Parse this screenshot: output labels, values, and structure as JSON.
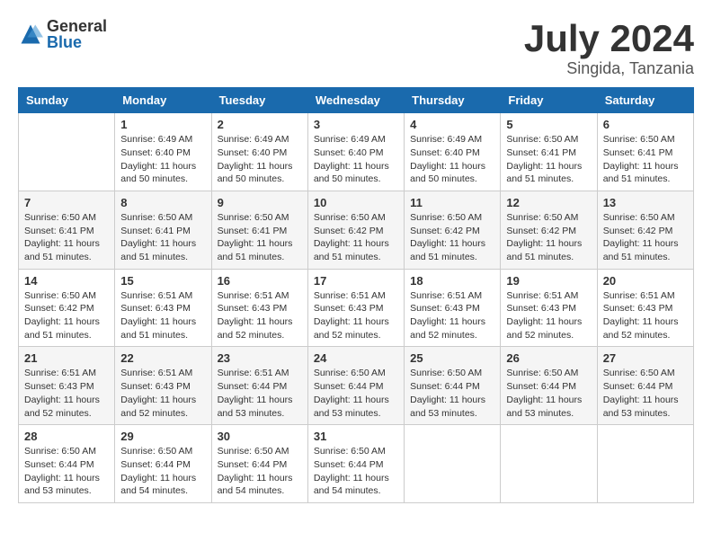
{
  "header": {
    "logo_general": "General",
    "logo_blue": "Blue",
    "month_year": "July 2024",
    "location": "Singida, Tanzania"
  },
  "weekdays": [
    "Sunday",
    "Monday",
    "Tuesday",
    "Wednesday",
    "Thursday",
    "Friday",
    "Saturday"
  ],
  "weeks": [
    [
      {
        "day": "",
        "details": ""
      },
      {
        "day": "1",
        "details": "Sunrise: 6:49 AM\nSunset: 6:40 PM\nDaylight: 11 hours\nand 50 minutes."
      },
      {
        "day": "2",
        "details": "Sunrise: 6:49 AM\nSunset: 6:40 PM\nDaylight: 11 hours\nand 50 minutes."
      },
      {
        "day": "3",
        "details": "Sunrise: 6:49 AM\nSunset: 6:40 PM\nDaylight: 11 hours\nand 50 minutes."
      },
      {
        "day": "4",
        "details": "Sunrise: 6:49 AM\nSunset: 6:40 PM\nDaylight: 11 hours\nand 50 minutes."
      },
      {
        "day": "5",
        "details": "Sunrise: 6:50 AM\nSunset: 6:41 PM\nDaylight: 11 hours\nand 51 minutes."
      },
      {
        "day": "6",
        "details": "Sunrise: 6:50 AM\nSunset: 6:41 PM\nDaylight: 11 hours\nand 51 minutes."
      }
    ],
    [
      {
        "day": "7",
        "details": "Sunrise: 6:50 AM\nSunset: 6:41 PM\nDaylight: 11 hours\nand 51 minutes."
      },
      {
        "day": "8",
        "details": "Sunrise: 6:50 AM\nSunset: 6:41 PM\nDaylight: 11 hours\nand 51 minutes."
      },
      {
        "day": "9",
        "details": "Sunrise: 6:50 AM\nSunset: 6:41 PM\nDaylight: 11 hours\nand 51 minutes."
      },
      {
        "day": "10",
        "details": "Sunrise: 6:50 AM\nSunset: 6:42 PM\nDaylight: 11 hours\nand 51 minutes."
      },
      {
        "day": "11",
        "details": "Sunrise: 6:50 AM\nSunset: 6:42 PM\nDaylight: 11 hours\nand 51 minutes."
      },
      {
        "day": "12",
        "details": "Sunrise: 6:50 AM\nSunset: 6:42 PM\nDaylight: 11 hours\nand 51 minutes."
      },
      {
        "day": "13",
        "details": "Sunrise: 6:50 AM\nSunset: 6:42 PM\nDaylight: 11 hours\nand 51 minutes."
      }
    ],
    [
      {
        "day": "14",
        "details": "Sunrise: 6:50 AM\nSunset: 6:42 PM\nDaylight: 11 hours\nand 51 minutes."
      },
      {
        "day": "15",
        "details": "Sunrise: 6:51 AM\nSunset: 6:43 PM\nDaylight: 11 hours\nand 51 minutes."
      },
      {
        "day": "16",
        "details": "Sunrise: 6:51 AM\nSunset: 6:43 PM\nDaylight: 11 hours\nand 52 minutes."
      },
      {
        "day": "17",
        "details": "Sunrise: 6:51 AM\nSunset: 6:43 PM\nDaylight: 11 hours\nand 52 minutes."
      },
      {
        "day": "18",
        "details": "Sunrise: 6:51 AM\nSunset: 6:43 PM\nDaylight: 11 hours\nand 52 minutes."
      },
      {
        "day": "19",
        "details": "Sunrise: 6:51 AM\nSunset: 6:43 PM\nDaylight: 11 hours\nand 52 minutes."
      },
      {
        "day": "20",
        "details": "Sunrise: 6:51 AM\nSunset: 6:43 PM\nDaylight: 11 hours\nand 52 minutes."
      }
    ],
    [
      {
        "day": "21",
        "details": "Sunrise: 6:51 AM\nSunset: 6:43 PM\nDaylight: 11 hours\nand 52 minutes."
      },
      {
        "day": "22",
        "details": "Sunrise: 6:51 AM\nSunset: 6:43 PM\nDaylight: 11 hours\nand 52 minutes."
      },
      {
        "day": "23",
        "details": "Sunrise: 6:51 AM\nSunset: 6:44 PM\nDaylight: 11 hours\nand 53 minutes."
      },
      {
        "day": "24",
        "details": "Sunrise: 6:50 AM\nSunset: 6:44 PM\nDaylight: 11 hours\nand 53 minutes."
      },
      {
        "day": "25",
        "details": "Sunrise: 6:50 AM\nSunset: 6:44 PM\nDaylight: 11 hours\nand 53 minutes."
      },
      {
        "day": "26",
        "details": "Sunrise: 6:50 AM\nSunset: 6:44 PM\nDaylight: 11 hours\nand 53 minutes."
      },
      {
        "day": "27",
        "details": "Sunrise: 6:50 AM\nSunset: 6:44 PM\nDaylight: 11 hours\nand 53 minutes."
      }
    ],
    [
      {
        "day": "28",
        "details": "Sunrise: 6:50 AM\nSunset: 6:44 PM\nDaylight: 11 hours\nand 53 minutes."
      },
      {
        "day": "29",
        "details": "Sunrise: 6:50 AM\nSunset: 6:44 PM\nDaylight: 11 hours\nand 54 minutes."
      },
      {
        "day": "30",
        "details": "Sunrise: 6:50 AM\nSunset: 6:44 PM\nDaylight: 11 hours\nand 54 minutes."
      },
      {
        "day": "31",
        "details": "Sunrise: 6:50 AM\nSunset: 6:44 PM\nDaylight: 11 hours\nand 54 minutes."
      },
      {
        "day": "",
        "details": ""
      },
      {
        "day": "",
        "details": ""
      },
      {
        "day": "",
        "details": ""
      }
    ]
  ]
}
